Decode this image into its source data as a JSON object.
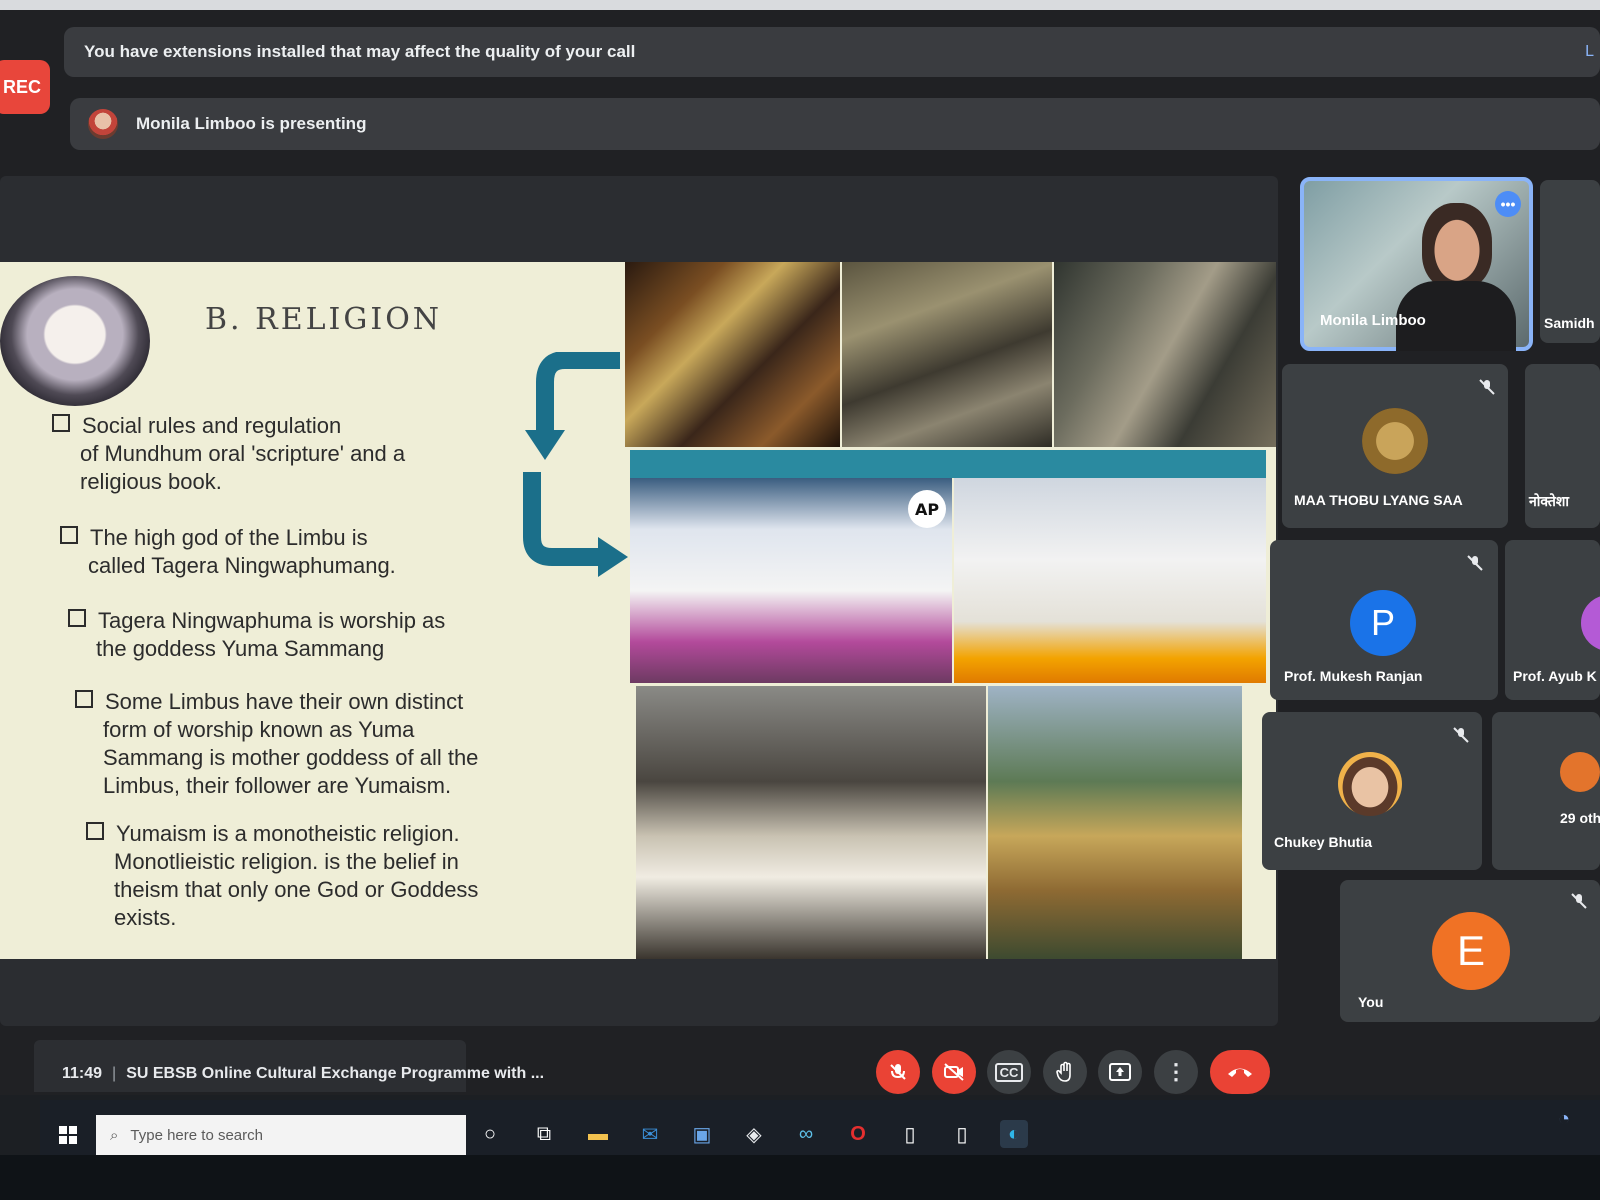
{
  "record_badge": "REC",
  "banners": {
    "extensions_warning": "You have extensions installed that may affect the quality of your call",
    "extensions_link": "L",
    "presenting": "Monila Limboo is presenting"
  },
  "slide": {
    "title": "B. RELIGION",
    "bullets": [
      {
        "line1": "Social rules and regulation",
        "rest": [
          "of Mundhum oral 'scripture' and a",
          "religious book."
        ]
      },
      {
        "line1": "The high god of the Limbu is",
        "rest": [
          "called Tagera Ningwaphumang."
        ]
      },
      {
        "line1": "Tagera Ningwaphuma is worship as",
        "rest": [
          "the goddess Yuma Sammang"
        ]
      },
      {
        "line1": "Some Limbus have their own distinct",
        "rest": [
          "form of worship known as Yuma",
          "Sammang is mother goddess of all the",
          "Limbus, their follower are Yumaism."
        ]
      },
      {
        "line1": "Yumaism is a monotheistic religion.",
        "rest": [
          "Monotlieistic religion. is the belief in",
          "theism that only one God or Goddess",
          "exists."
        ]
      }
    ],
    "logo_text": "AP"
  },
  "participants": {
    "pinned": {
      "name": "Monila Limboo",
      "more": "•••"
    },
    "partial_top": {
      "name": "Samidh"
    },
    "tiles": [
      {
        "name": "MAA THOBU LYANG SAA"
      },
      {
        "name": "Prof. Mukesh Ranjan",
        "initial": "P",
        "color": "#1a73e8"
      },
      {
        "name": "Chukey Bhutia"
      },
      {
        "name": "You",
        "initial": "E",
        "color": "#f07225"
      }
    ],
    "partial": {
      "name_1": "नोक्तेशा",
      "name_2": "Prof. Ayub K",
      "others": "29 oth"
    }
  },
  "meeting": {
    "time": "11:49",
    "title": "SU EBSB Online Cultural Exchange Programme with ..."
  },
  "controls": {
    "mic": "mic-off-icon",
    "camera": "camera-off-icon",
    "captions": "CC",
    "raise_hand": "hand-icon",
    "present": "present-icon",
    "more": "⋮",
    "leave": "end-call-icon"
  },
  "taskbar": {
    "search_placeholder": "Type here to search"
  }
}
